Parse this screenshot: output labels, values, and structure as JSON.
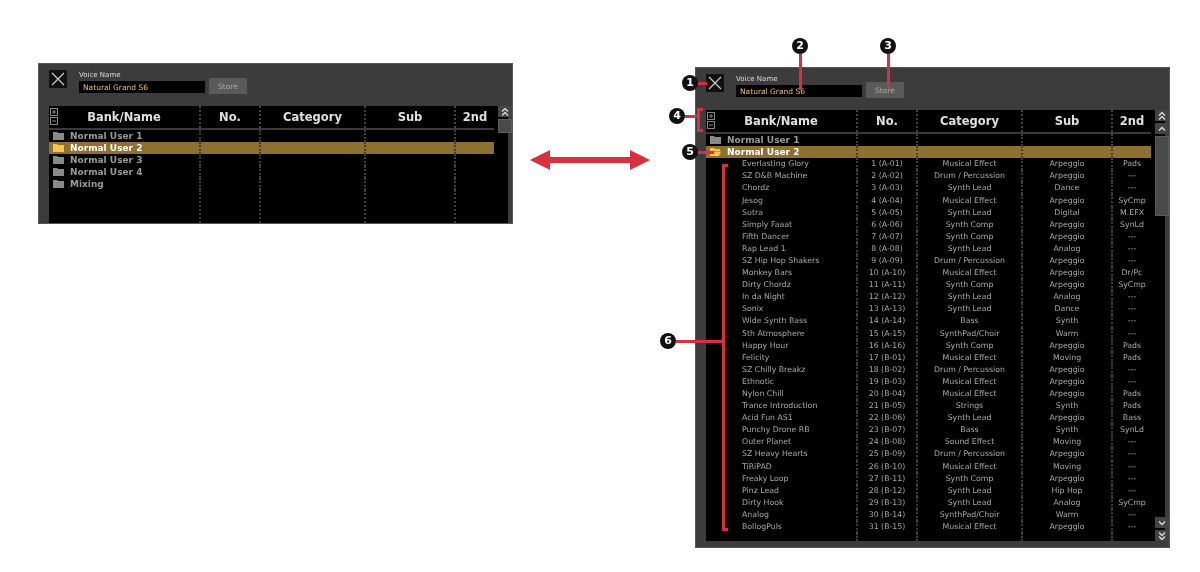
{
  "panels": [
    {
      "voice_name_label": "Voice Name",
      "voice_name": "Natural Grand S6",
      "store": "Store",
      "columns": [
        "Bank/Name",
        "No.",
        "Category",
        "Sub",
        "2nd"
      ],
      "tree": [
        {
          "name": "Normal User 1",
          "selected": false,
          "expanded": false
        },
        {
          "name": "Normal User 2",
          "selected": true,
          "expanded": false
        },
        {
          "name": "Normal User 3",
          "selected": false,
          "expanded": false
        },
        {
          "name": "Normal User 4",
          "selected": false,
          "expanded": false
        },
        {
          "name": "Mixing",
          "selected": false,
          "expanded": false
        }
      ]
    },
    {
      "voice_name_label": "Voice Name",
      "voice_name": "Natural Grand S6",
      "store": "Store",
      "columns": [
        "Bank/Name",
        "No.",
        "Category",
        "Sub",
        "2nd"
      ],
      "tree": [
        {
          "name": "Normal User 1",
          "selected": false,
          "expanded": false
        },
        {
          "name": "Normal User 2",
          "selected": true,
          "expanded": true,
          "children": [
            {
              "name": "Everlasting Glory",
              "no": "1 (A-01)",
              "category": "Musical Effect",
              "sub": "Arpeggio",
              "second": "Pads"
            },
            {
              "name": "SZ D&B Machine",
              "no": "2 (A-02)",
              "category": "Drum / Percussion",
              "sub": "Arpeggio",
              "second": "---"
            },
            {
              "name": "Chordz",
              "no": "3 (A-03)",
              "category": "Synth Lead",
              "sub": "Dance",
              "second": "---"
            },
            {
              "name": "Jesog",
              "no": "4 (A-04)",
              "category": "Musical Effect",
              "sub": "Arpeggio",
              "second": "SyCmp"
            },
            {
              "name": "Sutra",
              "no": "5 (A-05)",
              "category": "Synth Lead",
              "sub": "Digital",
              "second": "M.EFX"
            },
            {
              "name": "Simply Faaat",
              "no": "6 (A-06)",
              "category": "Synth Comp",
              "sub": "Arpeggio",
              "second": "SynLd"
            },
            {
              "name": "Fifth Dancer",
              "no": "7 (A-07)",
              "category": "Synth Comp",
              "sub": "Arpeggio",
              "second": "---"
            },
            {
              "name": "Rap Lead 1",
              "no": "8 (A-08)",
              "category": "Synth Lead",
              "sub": "Analog",
              "second": "---"
            },
            {
              "name": "SZ Hip Hop Shakers",
              "no": "9 (A-09)",
              "category": "Drum / Percussion",
              "sub": "Arpeggio",
              "second": "---"
            },
            {
              "name": "Monkey Bars",
              "no": "10 (A-10)",
              "category": "Musical Effect",
              "sub": "Arpeggio",
              "second": "Dr/Pc"
            },
            {
              "name": "Dirty Chordz",
              "no": "11 (A-11)",
              "category": "Synth Comp",
              "sub": "Arpeggio",
              "second": "SyCmp"
            },
            {
              "name": "In da Night",
              "no": "12 (A-12)",
              "category": "Synth Lead",
              "sub": "Analog",
              "second": "---"
            },
            {
              "name": "Sonix",
              "no": "13 (A-13)",
              "category": "Synth Lead",
              "sub": "Dance",
              "second": "---"
            },
            {
              "name": "Wide Synth Bass",
              "no": "14 (A-14)",
              "category": "Bass",
              "sub": "Synth",
              "second": "---"
            },
            {
              "name": "5th Atmosphere",
              "no": "15 (A-15)",
              "category": "SynthPad/Choir",
              "sub": "Warm",
              "second": "---"
            },
            {
              "name": "Happy Hour",
              "no": "16 (A-16)",
              "category": "Synth Comp",
              "sub": "Arpeggio",
              "second": "Pads"
            },
            {
              "name": "Felicity",
              "no": "17 (B-01)",
              "category": "Musical Effect",
              "sub": "Moving",
              "second": "Pads"
            },
            {
              "name": "SZ Chilly Breakz",
              "no": "18 (B-02)",
              "category": "Drum / Percussion",
              "sub": "Arpeggio",
              "second": "---"
            },
            {
              "name": "Ethnotic",
              "no": "19 (B-03)",
              "category": "Musical Effect",
              "sub": "Arpeggio",
              "second": "---"
            },
            {
              "name": "Nylon Chill",
              "no": "20 (B-04)",
              "category": "Musical Effect",
              "sub": "Arpeggio",
              "second": "Pads"
            },
            {
              "name": "Trance Introduction",
              "no": "21 (B-05)",
              "category": "Strings",
              "sub": "Synth",
              "second": "Pads"
            },
            {
              "name": "Acid Fun AS1",
              "no": "22 (B-06)",
              "category": "Synth Lead",
              "sub": "Arpeggio",
              "second": "Bass"
            },
            {
              "name": "Punchy Drone RB",
              "no": "23 (B-07)",
              "category": "Bass",
              "sub": "Synth",
              "second": "SynLd"
            },
            {
              "name": "Outer Planet",
              "no": "24 (B-08)",
              "category": "Sound Effect",
              "sub": "Moving",
              "second": "---"
            },
            {
              "name": "SZ Heavy Hearts",
              "no": "25 (B-09)",
              "category": "Drum / Percussion",
              "sub": "Arpeggio",
              "second": "---"
            },
            {
              "name": "TiRiPAD",
              "no": "26 (B-10)",
              "category": "Musical Effect",
              "sub": "Moving",
              "second": "---"
            },
            {
              "name": "Freaky Loop",
              "no": "27 (B-11)",
              "category": "Synth Comp",
              "sub": "Arpeggio",
              "second": "---"
            },
            {
              "name": "Pinz Lead",
              "no": "28 (B-12)",
              "category": "Synth Lead",
              "sub": "Hip Hop",
              "second": "---"
            },
            {
              "name": "Dirty Hook",
              "no": "29 (B-13)",
              "category": "Synth Lead",
              "sub": "Analog",
              "second": "SyCmp"
            },
            {
              "name": "Analog",
              "no": "30 (B-14)",
              "category": "SynthPad/Choir",
              "sub": "Warm",
              "second": "---"
            },
            {
              "name": "BollogPuls",
              "no": "31 (B-15)",
              "category": "Musical Effect",
              "sub": "Arpeggio",
              "second": "---"
            }
          ]
        }
      ]
    }
  ],
  "callouts": [
    "1",
    "2",
    "3",
    "4",
    "5",
    "6"
  ]
}
